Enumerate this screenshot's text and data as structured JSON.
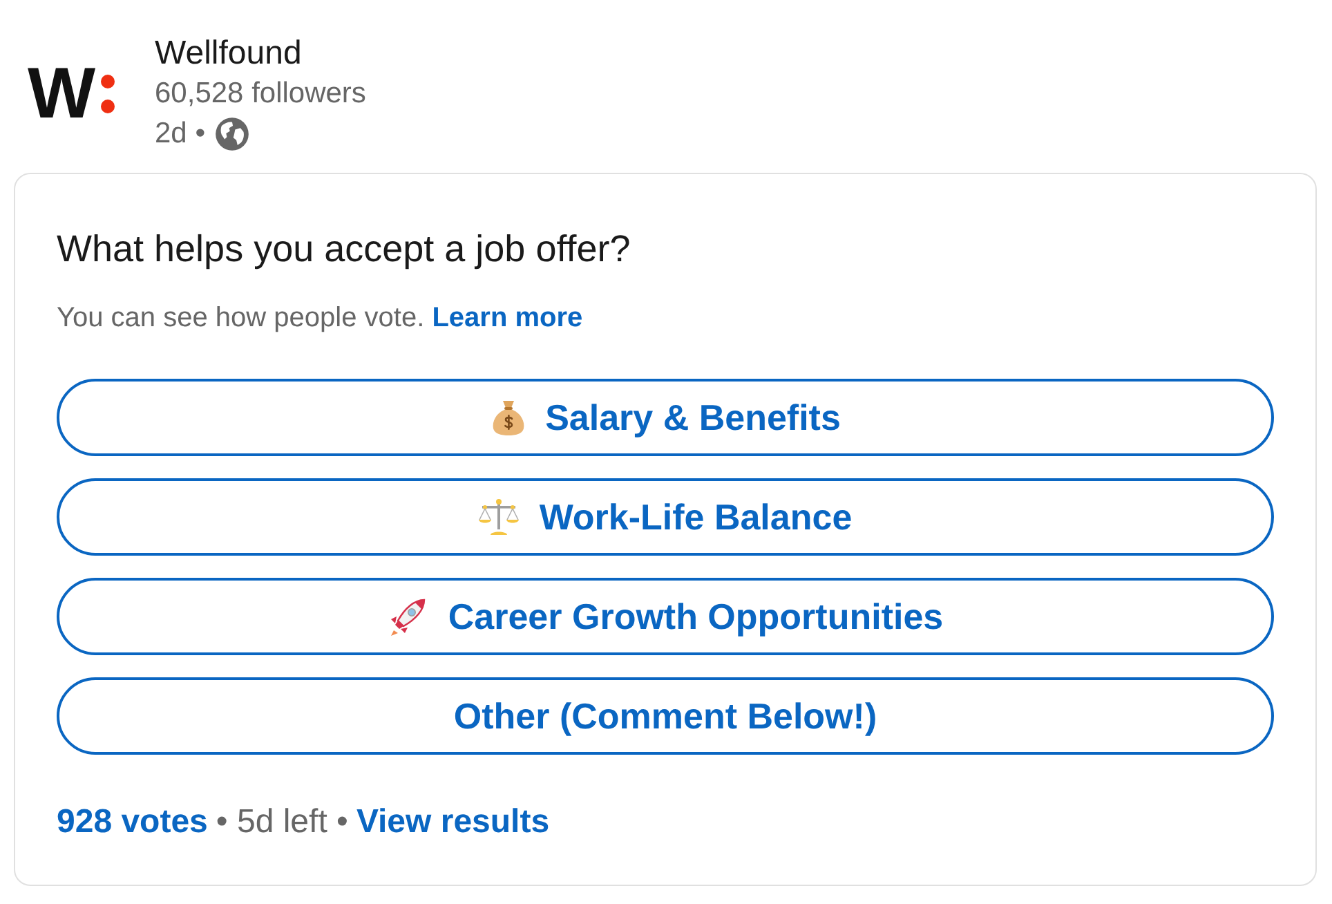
{
  "company": {
    "logo_letter": "W",
    "name": "Wellfound",
    "followers": "60,528 followers",
    "age": "2d •"
  },
  "poll": {
    "question": "What helps you accept a job offer?",
    "notice": "You can see how people vote.",
    "learn_more": "Learn more",
    "options": [
      {
        "label": "Salary & Benefits"
      },
      {
        "label": "Work-Life Balance"
      },
      {
        "label": "Career Growth Opportunities"
      },
      {
        "label": "Other (Comment Below!)"
      }
    ],
    "votes": "928 votes",
    "time_left": "• 5d left •",
    "view_results": "View results"
  }
}
